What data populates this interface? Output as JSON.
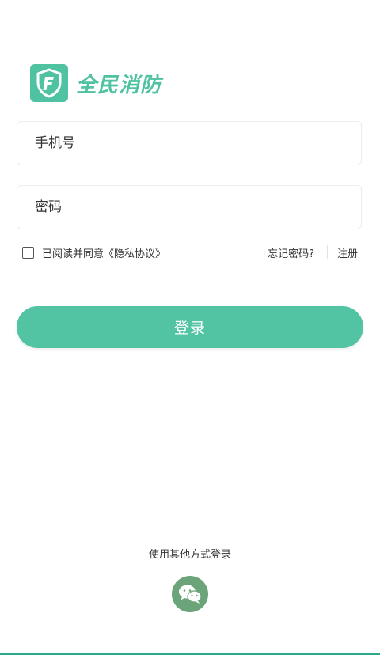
{
  "app": {
    "name": "全民消防",
    "logo_icon": "shield-f-icon",
    "brand_color": "#4fc3a1"
  },
  "login_form": {
    "phone_placeholder": "手机号",
    "password_placeholder": "密码",
    "agreement_text": "已阅读并同意《隐私协议》",
    "agreement_checked": false,
    "forgot_password_label": "忘记密码?",
    "register_label": "注册",
    "login_button_label": "登录"
  },
  "other_login": {
    "title": "使用其他方式登录",
    "wechat_icon": "wechat-icon"
  }
}
